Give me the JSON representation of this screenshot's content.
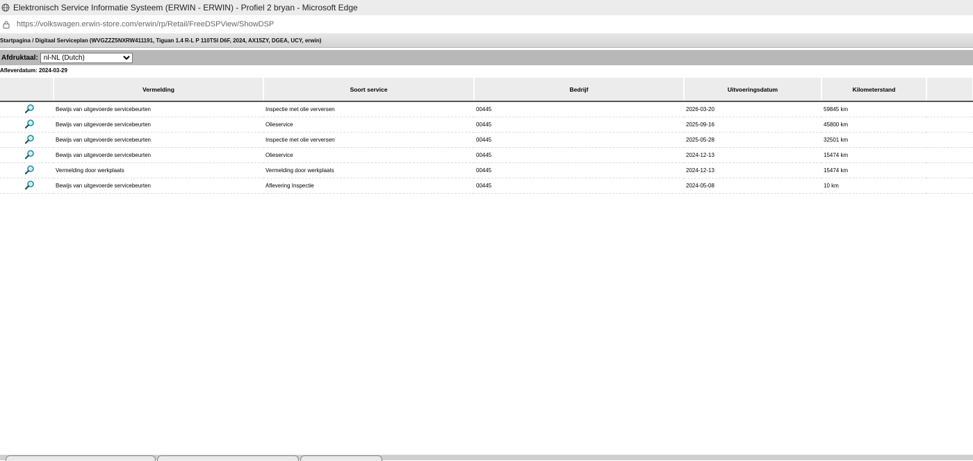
{
  "window": {
    "title": "Elektronisch Service Informatie Systeem (ERWIN - ERWIN) - Profiel 2 bryan - Microsoft Edge"
  },
  "address": {
    "url": "https://volkswagen.erwin-store.com/erwin/rp/Retail/FreeDSPView/ShowDSP"
  },
  "breadcrumb": {
    "text": "Startpagina / Digitaal Serviceplan (WVGZZZ5NXRW411191, Tiguan 1.4 R-L P 110TSI D6F, 2024, AX15ZY, DGEA, UCY, erwin)"
  },
  "language": {
    "label": "Afdruktaal:",
    "selected": "nl-NL (Dutch)"
  },
  "delivery": {
    "text": "Afleverdatum: 2024-03-29"
  },
  "table": {
    "headers": [
      "Vermelding",
      "Soort service",
      "Bedrijf",
      "Uitvoeringsdatum",
      "Kilometerstand"
    ],
    "rows": [
      {
        "vermelding": "Bewijs van uitgevoerde servicebeurten",
        "soort": "Inspectie met olie verversen",
        "bedrijf": "00445",
        "datum": "2026-03-20",
        "km": "59845 km"
      },
      {
        "vermelding": "Bewijs van uitgevoerde servicebeurten",
        "soort": "Olieservice",
        "bedrijf": "00445",
        "datum": "2025-09-16",
        "km": "45800 km"
      },
      {
        "vermelding": "Bewijs van uitgevoerde servicebeurten",
        "soort": "Inspectie met olie verversen",
        "bedrijf": "00445",
        "datum": "2025-05-28",
        "km": "32501 km"
      },
      {
        "vermelding": "Bewijs van uitgevoerde servicebeurten",
        "soort": "Olieservice",
        "bedrijf": "00445",
        "datum": "2024-12-13",
        "km": "15474 km"
      },
      {
        "vermelding": "Vermelding door werkplaats",
        "soort": "Vermelding door werkplaats",
        "bedrijf": "00445",
        "datum": "2024-12-13",
        "km": "15474 km"
      },
      {
        "vermelding": "Bewijs van uitgevoerde servicebeurten",
        "soort": "Aflevering Inspectie",
        "bedrijf": "00445",
        "datum": "2024-05-08",
        "km": "10 km"
      }
    ]
  },
  "icons": {
    "row_action": "magnifier-icon",
    "title": "globe-icon",
    "address": "lock-icon"
  },
  "colors": {
    "header_bg": "#ececec",
    "langbar_bg": "#b8b8b8",
    "icon_teal": "#2b8a9a"
  }
}
